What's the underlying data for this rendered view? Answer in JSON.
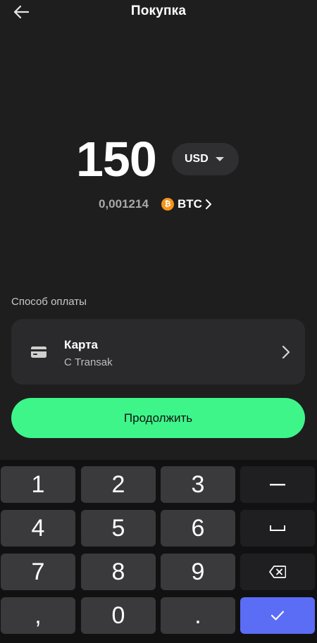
{
  "header": {
    "title": "Покупка",
    "back_icon": "arrow-left-icon"
  },
  "amount": {
    "value": "150",
    "currency": "USD"
  },
  "crypto": {
    "amount": "0,001214",
    "symbol": "BTC",
    "icon": "bitcoin-icon",
    "icon_glyph": "₿",
    "icon_color": "#f7931a"
  },
  "payment": {
    "section_label": "Способ оплаты",
    "method_title": "Карта",
    "method_subtitle": "С Transak",
    "icon": "credit-card-icon"
  },
  "continue_button": {
    "label": "Продолжить",
    "color": "#3ef58a"
  },
  "keypad": {
    "keys": [
      {
        "label": "1",
        "name": "key-1"
      },
      {
        "label": "2",
        "name": "key-2"
      },
      {
        "label": "3",
        "name": "key-3"
      },
      {
        "label": "–",
        "name": "key-minus"
      },
      {
        "label": "4",
        "name": "key-4"
      },
      {
        "label": "5",
        "name": "key-5"
      },
      {
        "label": "6",
        "name": "key-6"
      },
      {
        "label": "␣",
        "name": "key-space"
      },
      {
        "label": "7",
        "name": "key-7"
      },
      {
        "label": "8",
        "name": "key-8"
      },
      {
        "label": "9",
        "name": "key-9"
      },
      {
        "label": "⌫",
        "name": "key-backspace"
      },
      {
        "label": ",",
        "name": "key-comma"
      },
      {
        "label": "0",
        "name": "key-0"
      },
      {
        "label": ".",
        "name": "key-period"
      },
      {
        "label": "✓",
        "name": "key-confirm"
      }
    ],
    "confirm_color": "#5b6cf5"
  }
}
